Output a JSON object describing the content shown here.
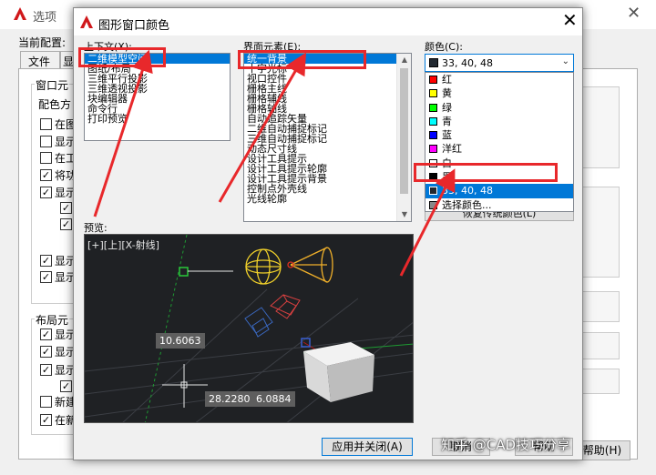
{
  "background_window": {
    "title": "选项",
    "current_config_label": "当前配置:",
    "tabs": [
      "文件",
      "显"
    ],
    "groups": [
      "窗口元",
      "布局元"
    ],
    "group1_first_caption": "配色方",
    "checks": [
      {
        "label": "在图",
        "checked": false
      },
      {
        "label": "显示",
        "checked": false
      },
      {
        "label": "在工",
        "checked": false
      },
      {
        "label": "将功",
        "checked": true
      },
      {
        "label": "显示",
        "checked": true
      },
      {
        "label": "显示",
        "checked": true
      },
      {
        "label": "显示",
        "checked": true
      }
    ],
    "sub_checks": [
      true,
      true
    ],
    "layout_checks": [
      {
        "label": "显示",
        "checked": true
      },
      {
        "label": "显示",
        "checked": true
      },
      {
        "label": "显示",
        "checked": true
      },
      {
        "label": "新建",
        "checked": false
      },
      {
        "label": "在新",
        "checked": true
      }
    ],
    "layout_sub_check": true,
    "bottom_button": "帮助(H)"
  },
  "dialog": {
    "title": "图形窗口颜色",
    "context_label": "上下文(X):",
    "element_label": "界面元素(E):",
    "color_label": "颜色(C):",
    "preview_label": "预览:",
    "context_items": [
      "二维模型空间",
      "图纸/布局",
      "三维平行投影",
      "三维透视投影",
      "块编辑器",
      "命令行",
      "打印预览"
    ],
    "context_selected": 0,
    "element_items": [
      "统一背景",
      "十字光标",
      "视口控件",
      "栅格主线",
      "栅格辅线",
      "栅格轴线",
      "自动追踪矢量",
      "二维自动捕捉标记",
      "三维自动捕捉标记",
      "动态尺寸线",
      "设计工具提示",
      "设计工具提示轮廓",
      "设计工具提示背景",
      "控制点外壳线",
      "光线轮廓"
    ],
    "element_selected": 0,
    "color_value": "33, 40, 48",
    "color_value_color": "#212830",
    "color_options": [
      {
        "label": "红",
        "color": "#ff0000"
      },
      {
        "label": "黄",
        "color": "#ffff00"
      },
      {
        "label": "绿",
        "color": "#00ff00"
      },
      {
        "label": "青",
        "color": "#00ffff"
      },
      {
        "label": "蓝",
        "color": "#0000ff"
      },
      {
        "label": "洋红",
        "color": "#ff00ff"
      },
      {
        "label": "白",
        "color": "#ffffff"
      },
      {
        "label": "黑",
        "color": "#000000"
      },
      {
        "label": "33, 40, 48",
        "color": "#212830"
      },
      {
        "label": "选择颜色...",
        "color": "#888888"
      }
    ],
    "color_selected": 8,
    "restore_button": "恢复传统颜色(L)",
    "preview": {
      "viewport_label": "[+][上][X-射线]",
      "dims": [
        "10.6063",
        "28.2280",
        "6.0884"
      ],
      "background": "#1f2124"
    },
    "apply_close_button": "应用并关闭(A)",
    "cancel_button": "取消",
    "help_button": "帮助"
  },
  "watermark": "知乎 @CAD技巧分享",
  "annotation_color": "#e8282b"
}
